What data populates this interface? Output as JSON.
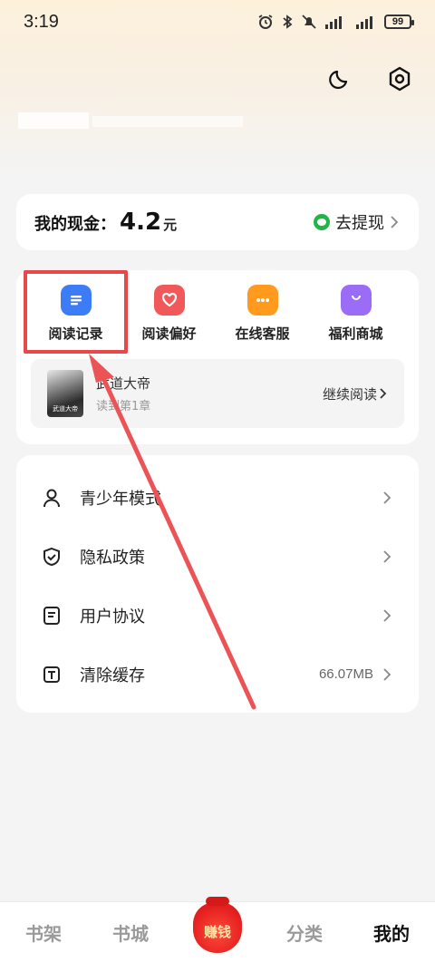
{
  "status_bar": {
    "time": "3:19",
    "battery": "99"
  },
  "cash": {
    "label": "我的现金：",
    "value": "4.2",
    "unit": "元",
    "withdraw_label": "去提现"
  },
  "tools": [
    {
      "label": "阅读记录",
      "icon": "reading-history-icon",
      "color": "#3d7cf7"
    },
    {
      "label": "阅读偏好",
      "icon": "heart-icon",
      "color": "#f0585a"
    },
    {
      "label": "在线客服",
      "icon": "chat-icon",
      "color": "#ff9a1f"
    },
    {
      "label": "福利商城",
      "icon": "shopping-bag-icon",
      "color": "#9b6cf5"
    }
  ],
  "recent_book": {
    "title": "武道大帝",
    "progress": "读到第1章",
    "action": "继续阅读"
  },
  "menu": [
    {
      "label": "青少年模式",
      "icon": "user-icon",
      "value": ""
    },
    {
      "label": "隐私政策",
      "icon": "shield-icon",
      "value": ""
    },
    {
      "label": "用户协议",
      "icon": "document-icon",
      "value": ""
    },
    {
      "label": "清除缓存",
      "icon": "text-box-icon",
      "value": "66.07MB"
    }
  ],
  "bottom_nav": {
    "items": [
      "书架",
      "书城",
      "分类",
      "我的"
    ],
    "earn_label": "赚钱",
    "active": "我的"
  }
}
